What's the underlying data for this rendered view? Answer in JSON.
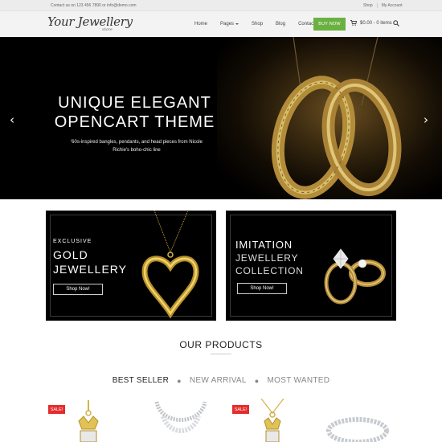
{
  "topbar": {
    "contact": "Contact us on 123 456 7890 or info@demo.com",
    "links": [
      "Shop",
      "My Account"
    ]
  },
  "header": {
    "logo_main": "Your Jewellery",
    "logo_sub": "store",
    "nav": [
      {
        "label": "Home",
        "dropdown": false
      },
      {
        "label": "Pages",
        "dropdown": true
      },
      {
        "label": "Shop",
        "dropdown": false
      },
      {
        "label": "Blog",
        "dropdown": false
      },
      {
        "label": "Contact",
        "dropdown": true
      }
    ],
    "buy_now": "BUY NOW",
    "cart": "$0.00 - 0 items",
    "accent_color": "#6bb141"
  },
  "hero": {
    "title": "UNIQUE ELEGANT OPENCART THEME",
    "subtitle": "'60s-inspired bangles, pendants, and head pieces from Nicole Richie's boho-chic line",
    "prev_icon": "chevron-left-icon",
    "next_icon": "chevron-right-icon"
  },
  "banners": [
    {
      "lines": [
        "EXCLUSIVE",
        "GOLD",
        "JEWELLERY"
      ],
      "button": "Shop Now!",
      "image": "gold-heart-pendant"
    },
    {
      "lines": [
        "IMITATION",
        "JEWELLERY",
        "COLLECTION"
      ],
      "button": "Shop Now!",
      "image": "diamond-rings"
    }
  ],
  "products_section": {
    "title": "OUR PRODUCTS",
    "tabs": [
      "BEST SELLER",
      "NEW ARRIVAL",
      "MOST WANTED"
    ],
    "active_tab": "BEST SELLER",
    "sale_label": "SALE!",
    "sale_color": "#e52c2c"
  }
}
